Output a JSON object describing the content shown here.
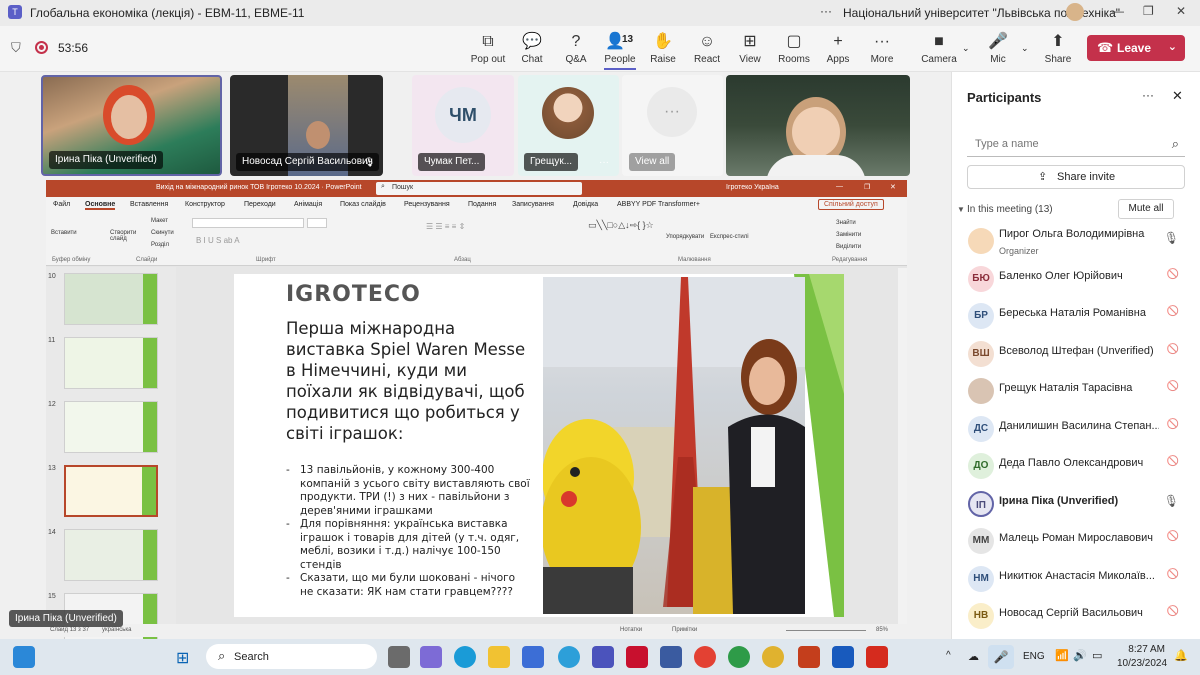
{
  "window": {
    "title": "Глобальна економіка (лекція) - ЕВМ-11, ЕВМЕ-11",
    "org": "Національний університет \"Львівська політехніка\"",
    "more": "···"
  },
  "meeting": {
    "timer": "53:56",
    "people_count": "13"
  },
  "toolbar": [
    {
      "id": "pop-out",
      "icon": "⧉",
      "label": "Pop out"
    },
    {
      "id": "chat",
      "icon": "💬",
      "label": "Chat"
    },
    {
      "id": "qa",
      "icon": "?",
      "label": "Q&A"
    },
    {
      "id": "people",
      "icon": "👤",
      "label": "People"
    },
    {
      "id": "raise",
      "icon": "✋",
      "label": "Raise"
    },
    {
      "id": "react",
      "icon": "☺",
      "label": "React"
    },
    {
      "id": "view",
      "icon": "⊞",
      "label": "View"
    },
    {
      "id": "rooms",
      "icon": "▢",
      "label": "Rooms"
    },
    {
      "id": "apps",
      "icon": "+",
      "label": "Apps"
    },
    {
      "id": "more",
      "icon": "···",
      "label": "More"
    },
    {
      "id": "camera",
      "icon": "■",
      "label": "Camera"
    },
    {
      "id": "mic",
      "icon": "🎤",
      "label": "Mic"
    },
    {
      "id": "share",
      "icon": "⬆",
      "label": "Share"
    }
  ],
  "leave_label": "Leave",
  "videos": [
    {
      "name": "Ірина Піка (Unverified)"
    },
    {
      "name": "Новосад Сергій Васильович"
    },
    {
      "name": "Чумак Пет...",
      "initials": "ЧМ"
    },
    {
      "name": "Грещук...",
      "more": "···"
    },
    {
      "name": "View all",
      "icon": "···"
    },
    {
      "name": ""
    }
  ],
  "panel": {
    "title": "Participants",
    "search_placeholder": "Type a name",
    "share_invite": "Share invite",
    "section": "In this meeting (13)",
    "mute_all": "Mute all",
    "organizer": "Organizer",
    "participants": [
      {
        "initials": "",
        "name": "Пирог Ольга Володимирівна",
        "color": "#f6d9b8",
        "text": "#6b4a2a",
        "mic": "on"
      },
      {
        "initials": "БЮ",
        "name": "Баленко Олег Юрійович",
        "color": "#f8d7da",
        "text": "#8a2c3a",
        "mic": "off"
      },
      {
        "initials": "БР",
        "name": "Берeська Наталія Романівна",
        "color": "#dde7f4",
        "text": "#2f4f7a",
        "mic": "off"
      },
      {
        "initials": "ВШ",
        "name": "Всеволод Штефан (Unverified)",
        "color": "#f3dfd2",
        "text": "#7b4a2e",
        "mic": "off"
      },
      {
        "initials": "",
        "name": "Грещук Наталія Тарасівна",
        "color": "#d9c4b3",
        "text": "#5a3f2c",
        "mic": "off"
      },
      {
        "initials": "ДС",
        "name": "Данилишин Василина Степан...",
        "color": "#dde7f4",
        "text": "#2f4f7a",
        "mic": "off"
      },
      {
        "initials": "ДО",
        "name": "Деда Павло Олександрович",
        "color": "#dff0dc",
        "text": "#2f6b2a",
        "mic": "off"
      },
      {
        "initials": "ІП",
        "name": "Ірина Піка (Unverified)",
        "color": "#e6e6f2",
        "text": "#4a4a7a",
        "mic": "on"
      },
      {
        "initials": "ММ",
        "name": "Малець Роман Мирославович",
        "color": "#e5e5e5",
        "text": "#444",
        "mic": "off"
      },
      {
        "initials": "НМ",
        "name": "Никитюк Анастасія Миколаїв...",
        "color": "#dde7f4",
        "text": "#2f4f7a",
        "mic": "off"
      },
      {
        "initials": "НВ",
        "name": "Новосад Сергій Васильович",
        "color": "#faeec9",
        "text": "#7a5a12",
        "mic": "off"
      }
    ]
  },
  "ppt": {
    "doc_title": "Вихід на міжнародний ринок ТОВ Ігротеко 10.2024 · PowerPoint",
    "search": "Пошук",
    "user": "Ігротеко Україна",
    "tabs": [
      "Файл",
      "Основне",
      "Вставлення",
      "Конструктор",
      "Переходи",
      "Анімація",
      "Показ слайдів",
      "Рецензування",
      "Подання",
      "Записування",
      "Довідка",
      "ABBYY PDF Transformer+"
    ],
    "share_btn": "Спільний доступ",
    "ribbon_groups": [
      "Буфер обміну",
      "Слайди",
      "Шрифт",
      "Абзац",
      "Малювання",
      "Редагування"
    ],
    "ribbon_buttons": {
      "paste": "Вставити",
      "new_slide": "Створити слайд",
      "layout": "Макет",
      "reset": "Скинути",
      "section": "Розділ",
      "arrange": "Упорядкувати",
      "quick_styles": "Експрес-стилі",
      "find": "Знайти",
      "replace": "Замінити",
      "select": "Виділити"
    },
    "thumbs": [
      "10",
      "11",
      "12",
      "13",
      "14",
      "15"
    ],
    "status": {
      "slide": "Слайд 13 з 37",
      "lang": "українська",
      "notes": "Нотатки",
      "comments": "Примітки",
      "zoom": "85%"
    }
  },
  "slide": {
    "logo": "IGROTECO",
    "heading": "Перша міжнародна виставка Spiel Waren Messe в Німеччині, куди ми поїхали як відвідувачі, щоб подивитися що робиться у світі іграшок:",
    "bullets": [
      "13 павільйонів, у кожному 300-400 компаній з усього світу виставляють свої продукти. ТРИ (!) з них - павільйони з дерев'яними іграшками",
      "Для порівняння: українська виставка іграшок і товарів для дітей (у т.ч. одяг, меблі, возики і т.д.) налічує 100-150 стендів",
      "Сказати, що ми були шоковані - нічого не сказати: ЯК нам стати гравцем????"
    ]
  },
  "speaker_label": "Ірина Піка (Unverified)",
  "taskbar": {
    "search": "Search",
    "lang": "ENG",
    "time": "8:27 AM",
    "date": "10/23/2024"
  }
}
